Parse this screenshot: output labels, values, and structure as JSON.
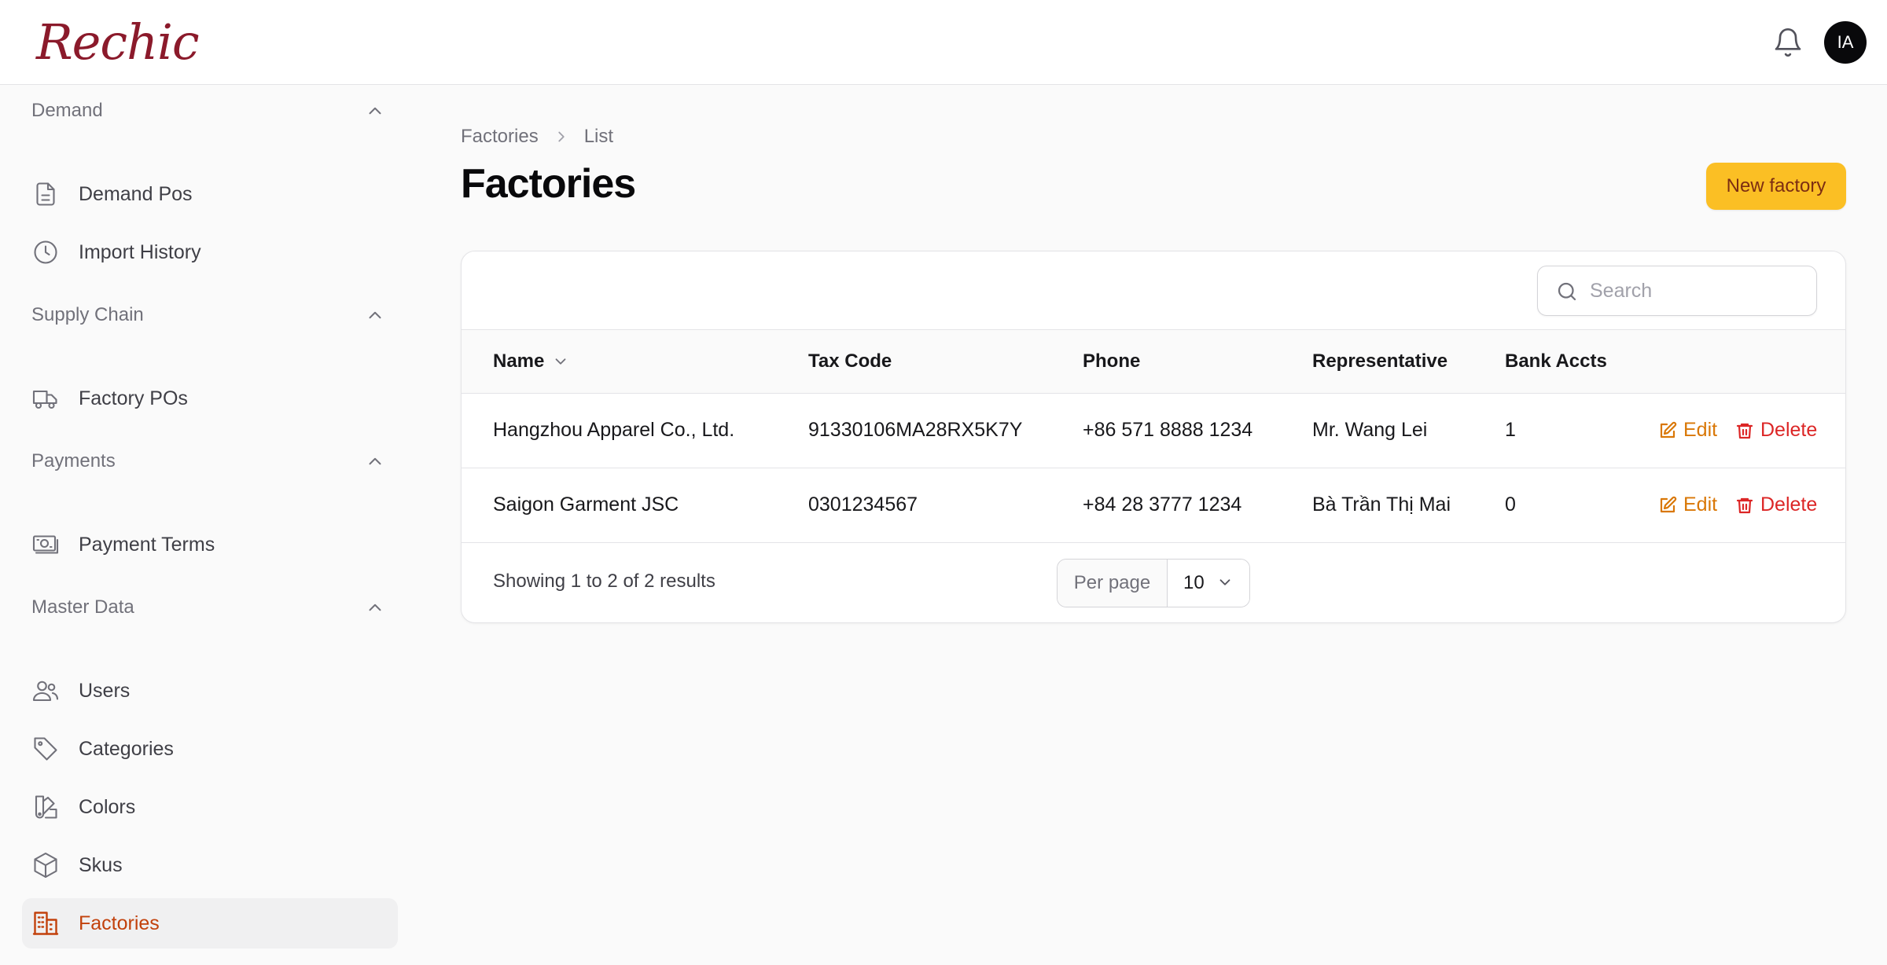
{
  "header": {
    "logo": "Rechic",
    "avatar_initials": "IA"
  },
  "sidebar": {
    "groups": [
      {
        "label": "Demand",
        "items": [
          {
            "label": "Demand Pos",
            "icon": "document-icon"
          },
          {
            "label": "Import History",
            "icon": "clock-icon"
          }
        ]
      },
      {
        "label": "Supply Chain",
        "items": [
          {
            "label": "Factory POs",
            "icon": "truck-icon"
          }
        ]
      },
      {
        "label": "Payments",
        "items": [
          {
            "label": "Payment Terms",
            "icon": "banknote-icon"
          }
        ]
      },
      {
        "label": "Master Data",
        "items": [
          {
            "label": "Users",
            "icon": "users-icon"
          },
          {
            "label": "Categories",
            "icon": "tag-icon"
          },
          {
            "label": "Colors",
            "icon": "swatch-icon"
          },
          {
            "label": "Skus",
            "icon": "cube-icon"
          },
          {
            "label": "Factories",
            "icon": "building-icon",
            "active": true
          }
        ]
      }
    ]
  },
  "page": {
    "breadcrumb": [
      "Factories",
      "List"
    ],
    "title": "Factories",
    "new_button": "New factory"
  },
  "table": {
    "search_placeholder": "Search",
    "columns": [
      "Name",
      "Tax Code",
      "Phone",
      "Representative",
      "Bank Accts"
    ],
    "rows": [
      {
        "name": "Hangzhou Apparel Co., Ltd.",
        "tax_code": "91330106MA28RX5K7Y",
        "phone": "+86 571 8888 1234",
        "representative": "Mr. Wang Lei",
        "bank_accts": "1",
        "edit": "Edit",
        "delete": "Delete"
      },
      {
        "name": "Saigon Garment JSC",
        "tax_code": "0301234567",
        "phone": "+84 28 3777 1234",
        "representative": "Bà Trần Thị Mai",
        "bank_accts": "0",
        "edit": "Edit",
        "delete": "Delete"
      }
    ],
    "summary": "Showing 1 to 2 of 2 results",
    "per_page_label": "Per page",
    "per_page_value": "10"
  },
  "colors": {
    "brand": "#8b1a2b",
    "primary_button": "#fbbf24",
    "active_nav": "#c2410c",
    "edit_action": "#d97706",
    "delete_action": "#dc2626"
  }
}
